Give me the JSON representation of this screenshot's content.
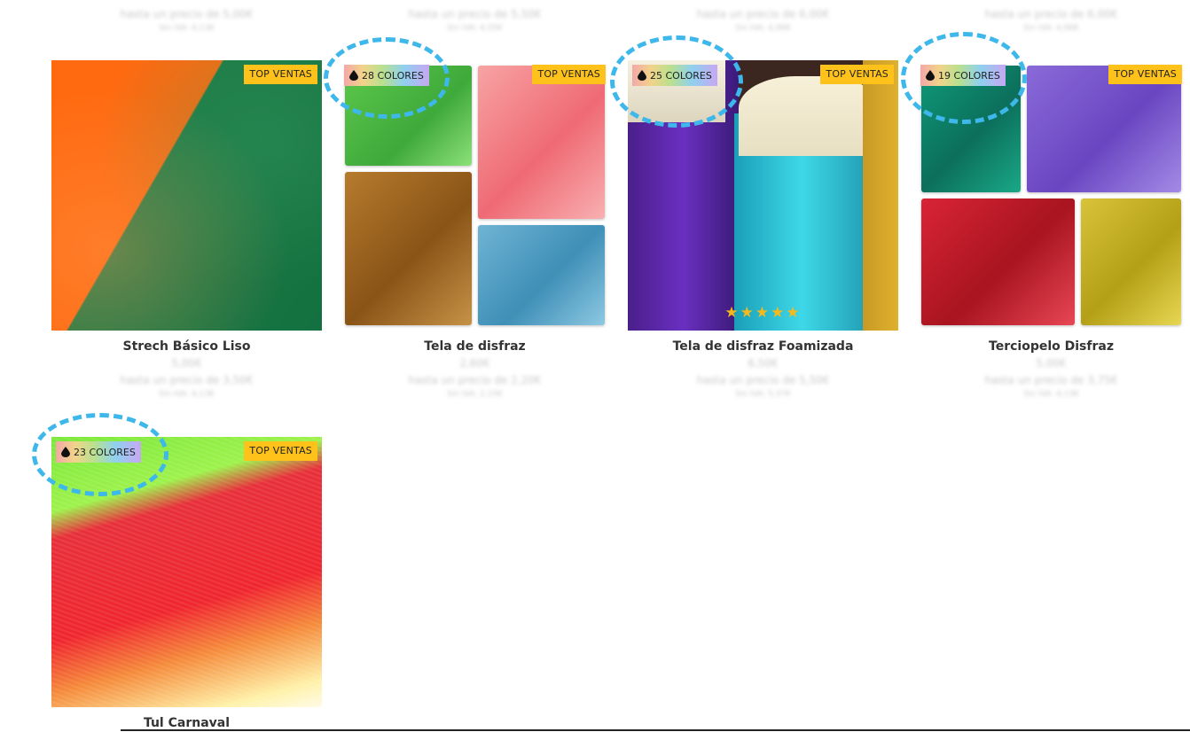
{
  "top_row_fragments": [
    {
      "from": "hasta un precio de 5,00€",
      "tax": "Sin IVA: 4,13€"
    },
    {
      "from": "hasta un precio de 5,50€",
      "tax": "Sin IVA: 4,55€"
    },
    {
      "from": "hasta un precio de 6,00€",
      "tax": "Sin IVA: 4,96€"
    },
    {
      "from": "hasta un precio de 6,00€",
      "tax": "Sin IVA: 4,96€"
    }
  ],
  "badge_top_ventas": "TOP VENTAS",
  "products": [
    {
      "name": "Strech Básico Liso",
      "colors": "",
      "price": "5,00€",
      "from": "hasta un precio de 3,50€",
      "tax": "Sin IVA: 4,13€",
      "rating": ""
    },
    {
      "name": "Tela de disfraz",
      "colors": "28 COLORES",
      "price": "2,60€",
      "from": "hasta un precio de 2,20€",
      "tax": "Sin IVA: 2,15€",
      "rating": ""
    },
    {
      "name": "Tela de disfraz Foamizada",
      "colors": "25 COLORES",
      "price": "6,50€",
      "from": "hasta un precio de 5,50€",
      "tax": "Sin IVA: 5,37€",
      "rating": "★★★★★"
    },
    {
      "name": "Terciopelo Disfraz",
      "colors": "19 COLORES",
      "price": "5,00€",
      "from": "hasta un precio de 3,75€",
      "tax": "Sin IVA: 4,13€",
      "rating": ""
    },
    {
      "name": "Tul Carnaval",
      "colors": "23 COLORES",
      "price": "",
      "from": "",
      "tax": "",
      "rating": ""
    }
  ],
  "colors": {
    "accent_badge": "#ffc21a",
    "highlight_circle": "#3eb7ea"
  }
}
